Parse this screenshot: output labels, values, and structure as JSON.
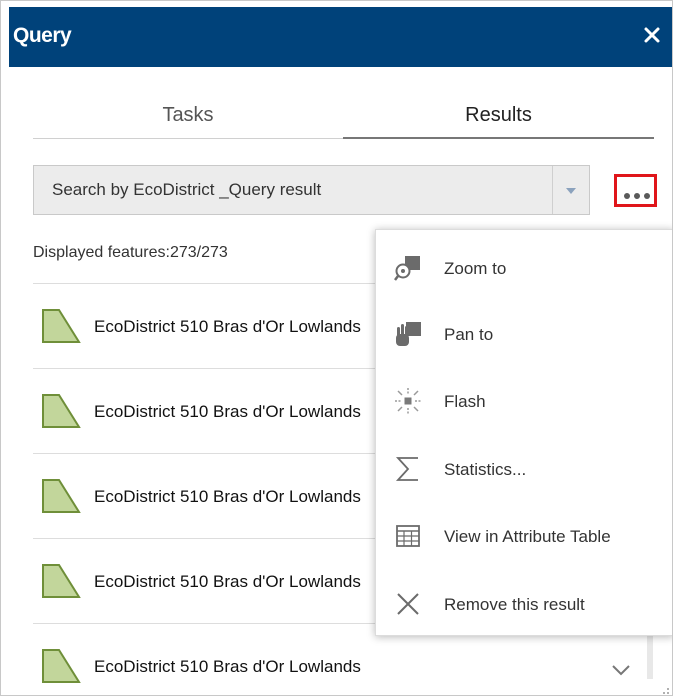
{
  "window": {
    "title": "Query",
    "close_icon": "close-icon"
  },
  "tabs": [
    {
      "label": "Tasks",
      "active": false
    },
    {
      "label": "Results",
      "active": true
    }
  ],
  "result_select": {
    "value": "Search by EcoDistrict _Query result",
    "icon": "dropdown-arrow-icon"
  },
  "more_button": {
    "icon": "more-options-icon",
    "highlight_color": "#e0151a"
  },
  "features": {
    "count_text": "Displayed features:273/273"
  },
  "results": [
    {
      "label": "EcoDistrict 510 Bras d'Or Lowlands"
    },
    {
      "label": "EcoDistrict 510 Bras d'Or Lowlands"
    },
    {
      "label": "EcoDistrict 510 Bras d'Or Lowlands"
    },
    {
      "label": "EcoDistrict 510 Bras d'Or Lowlands"
    },
    {
      "label": "EcoDistrict 510 Bras d'Or Lowlands"
    }
  ],
  "menu": {
    "items": [
      {
        "label": "Zoom to",
        "icon": "zoom-to-icon"
      },
      {
        "label": "Pan to",
        "icon": "pan-to-icon"
      },
      {
        "label": "Flash",
        "icon": "flash-icon"
      },
      {
        "label": "Statistics...",
        "icon": "statistics-icon"
      },
      {
        "label": "View in Attribute Table",
        "icon": "attribute-table-icon"
      },
      {
        "label": "Remove this result",
        "icon": "remove-icon"
      }
    ]
  },
  "colors": {
    "header": "#00427a",
    "polygon_fill": "#c2d69b",
    "polygon_stroke": "#6f8f39",
    "menu_icon": "#6b6b6b"
  }
}
